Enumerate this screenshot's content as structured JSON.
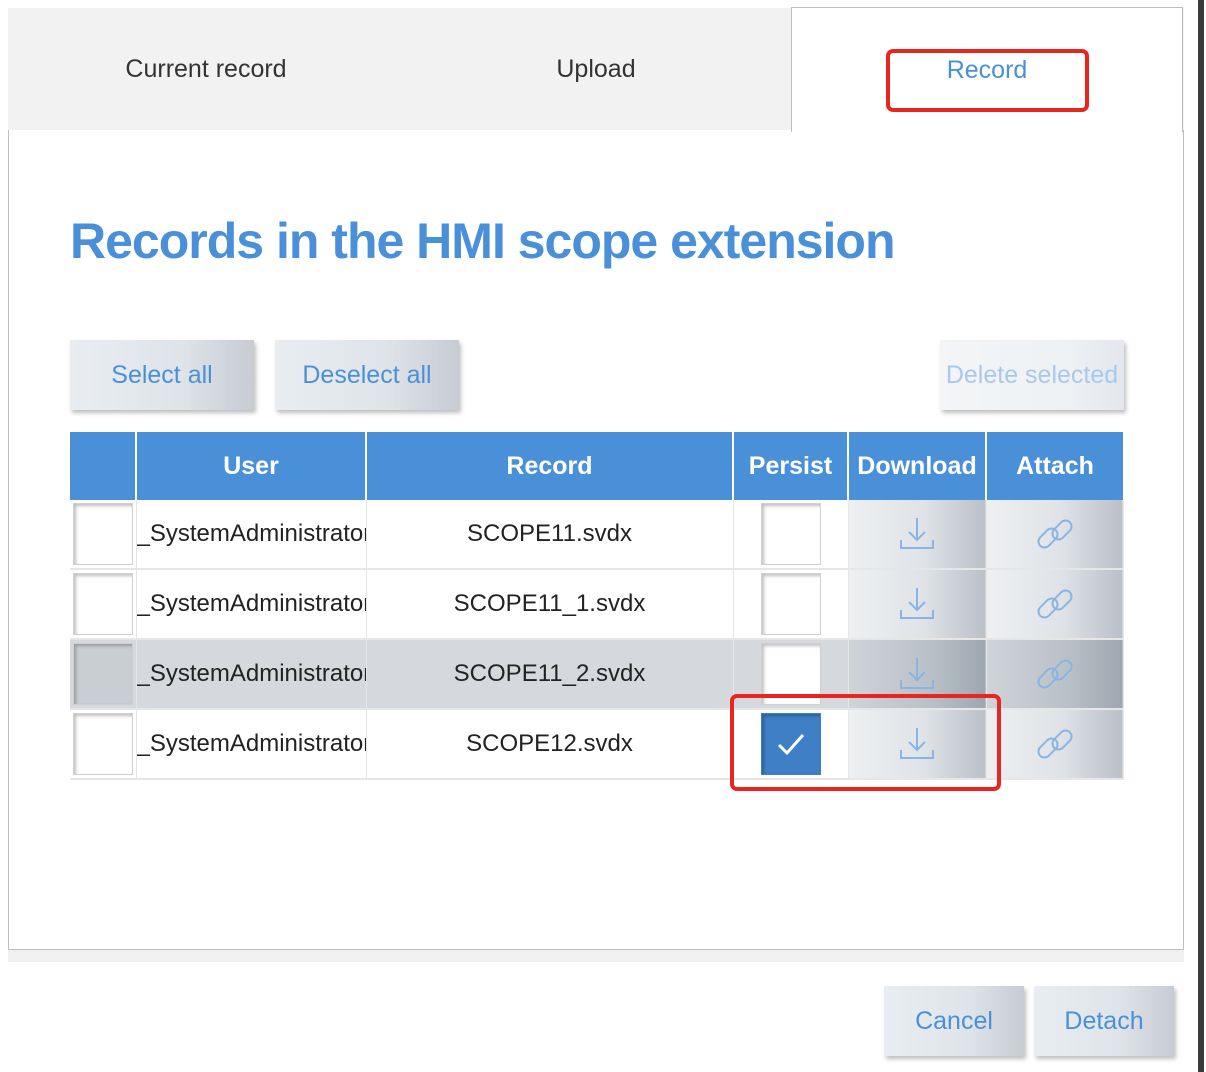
{
  "tabs": [
    {
      "label": "Current record"
    },
    {
      "label": "Upload"
    },
    {
      "label": "Record",
      "active": true
    }
  ],
  "title": "Records in the HMI scope extension",
  "buttons": {
    "select_all": "Select all",
    "deselect_all": "Deselect all",
    "delete_selected": "Delete selected",
    "cancel": "Cancel",
    "detach": "Detach"
  },
  "table": {
    "headers": [
      "",
      "User",
      "Record",
      "Persist",
      "Download",
      "Attach"
    ],
    "rows": [
      {
        "selected": false,
        "user": "_SystemAdministrator",
        "record": "SCOPE11.svdx",
        "persist": false
      },
      {
        "selected": false,
        "user": "_SystemAdministrator",
        "record": "SCOPE11_1.svdx",
        "persist": false
      },
      {
        "selected": false,
        "user": "_SystemAdministrator",
        "record": "SCOPE11_2.svdx",
        "persist": false,
        "hovered": true
      },
      {
        "selected": false,
        "user": "_SystemAdministrator",
        "record": "SCOPE12.svdx",
        "persist": true
      }
    ]
  },
  "icons": {
    "download": "download-icon",
    "attach": "link-icon",
    "check": "check-icon"
  },
  "colors": {
    "accent": "#4a90d9",
    "header_bg": "#4a90d9",
    "checked_bg": "#3f7fc6",
    "highlight": "#e8261f"
  }
}
